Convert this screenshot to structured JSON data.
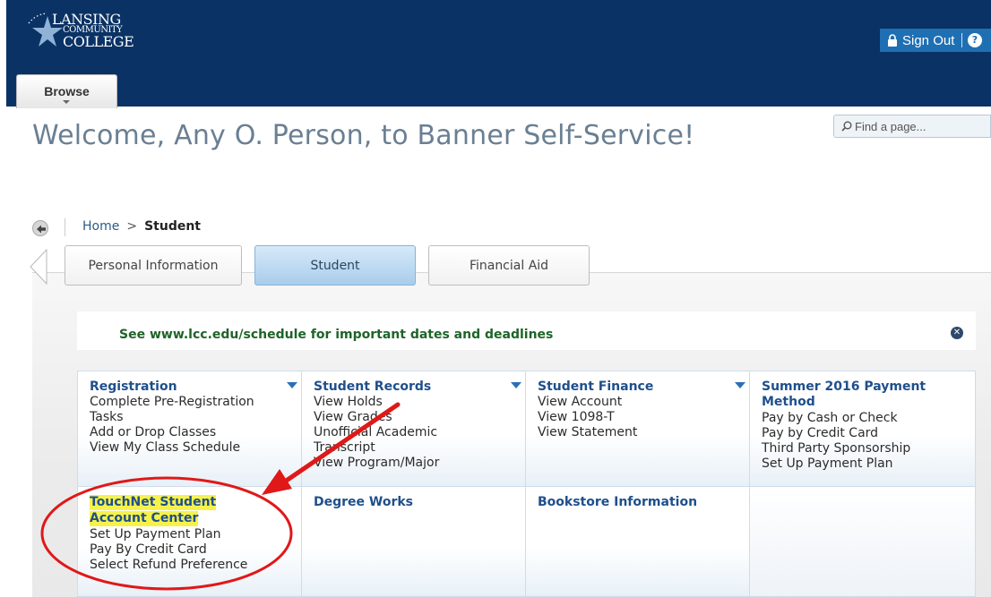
{
  "header": {
    "logo_line1": "LANSING",
    "logo_line2": "COMMUNITY",
    "logo_line3": "COLLEGE",
    "signout_label": "Sign Out",
    "browse_label": "Browse",
    "find_placeholder": "Find a page..."
  },
  "welcome_text": "Welcome, Any O. Person, to Banner Self-Service!",
  "breadcrumb": {
    "home": "Home",
    "separator": ">",
    "current": "Student"
  },
  "tabs": [
    {
      "label": "Personal Information",
      "active": false
    },
    {
      "label": "Student",
      "active": true
    },
    {
      "label": "Financial Aid",
      "active": false
    }
  ],
  "announcement": {
    "text": "See www.lcc.edu/schedule for important dates and deadlines"
  },
  "menu": {
    "registration": {
      "title": "Registration",
      "links": [
        "Complete Pre-Registration",
        "Tasks",
        "Add or Drop Classes",
        "View My Class Schedule"
      ]
    },
    "student_records": {
      "title": "Student Records",
      "links": [
        "View Holds",
        "View Grades",
        "Unofficial Academic",
        "Transcript",
        "View Program/Major"
      ]
    },
    "student_finance": {
      "title": "Student Finance",
      "links": [
        "View Account",
        "View 1098-T",
        "View Statement"
      ]
    },
    "summer_payment": {
      "title_line1": "Summer 2016 Payment",
      "title_line2": "Method",
      "links": [
        "Pay by Cash or Check",
        "Pay by Credit Card",
        "Third Party Sponsorship",
        "Set Up Payment Plan"
      ]
    },
    "touchnet": {
      "title_line1": "TouchNet Student",
      "title_line2": "Account Center",
      "links": [
        "Set Up Payment Plan",
        "Pay By Credit Card",
        "Select Refund Preference"
      ]
    },
    "degree_works": {
      "title": "Degree Works"
    },
    "bookstore": {
      "title": "Bookstore Information"
    }
  },
  "colors": {
    "header_bg": "#0a3265",
    "link_blue": "#1f4f8c",
    "announce_green": "#1e6428",
    "annotation_red": "#e01818",
    "highlight_yellow": "#f6f24a"
  }
}
